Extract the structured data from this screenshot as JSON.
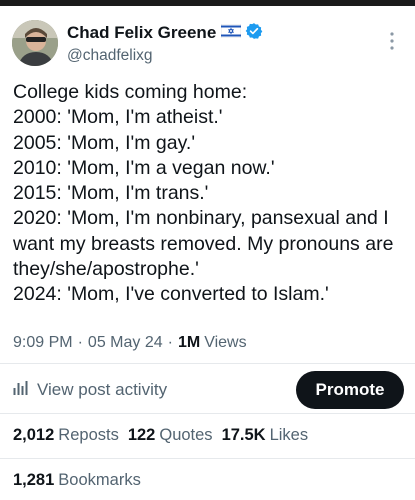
{
  "author": {
    "display_name": "Chad Felix Greene",
    "handle": "@chadfelixg",
    "flag_icon": "israel-flag-icon",
    "verified_icon": "verified-badge-icon",
    "verified_color": "#1d9bf0"
  },
  "tweet": {
    "text": "College kids coming home:\n2000: 'Mom, I'm atheist.'\n2005: 'Mom, I'm gay.'\n2010: 'Mom, I'm a vegan now.'\n2015: 'Mom, I'm trans.'\n2020: 'Mom, I'm nonbinary, pansexual and I want my breasts removed. My pronouns are they/she/apostrophe.'\n2024: 'Mom, I've converted to Islam.'"
  },
  "meta": {
    "time": "9:09 PM",
    "date": "05 May 24",
    "separator": "·",
    "views_count": "1M",
    "views_label": "Views"
  },
  "activity": {
    "label": "View post activity",
    "icon": "analytics-bar-icon"
  },
  "promote": {
    "label": "Promote"
  },
  "stats": {
    "reposts_count": "2,012",
    "reposts_label": "Reposts",
    "quotes_count": "122",
    "quotes_label": "Quotes",
    "likes_count": "17.5K",
    "likes_label": "Likes"
  },
  "bookmarks": {
    "count": "1,281",
    "label": "Bookmarks"
  },
  "colors": {
    "text_primary": "#0f1419",
    "text_secondary": "#536471",
    "divider": "#e6e9ec",
    "button_bg": "#0f1419"
  }
}
